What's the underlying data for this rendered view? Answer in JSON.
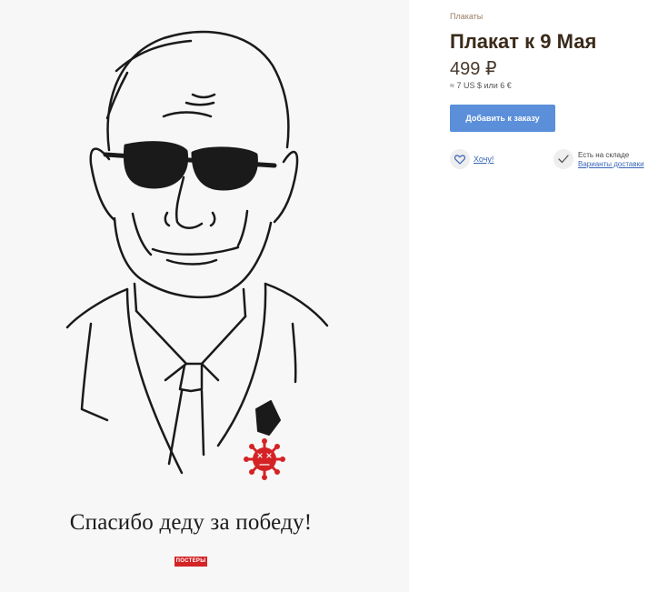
{
  "poster": {
    "caption": "Спасибо деду за победу!",
    "brand_logo_text": "ПОСТЕРЫ",
    "accent_color": "#d42325"
  },
  "product": {
    "breadcrumb": "Плакаты",
    "title": "Плакат к 9 Мая",
    "price": "499 ₽",
    "price_alt": "≈ 7 US $ или 6 €",
    "add_to_order_label": "Добавить к заказу",
    "wishlist_label": "Хочу!",
    "stock_status": "Есть на складе",
    "delivery_link_label": "Варианты доставки"
  },
  "colors": {
    "button": "#5b8fd9",
    "title": "#3a2a1a",
    "link": "#3a66b8",
    "breadcrumb": "#9a7b62"
  },
  "icons": {
    "wishlist": "heart-icon",
    "stock": "checkmark-icon"
  }
}
